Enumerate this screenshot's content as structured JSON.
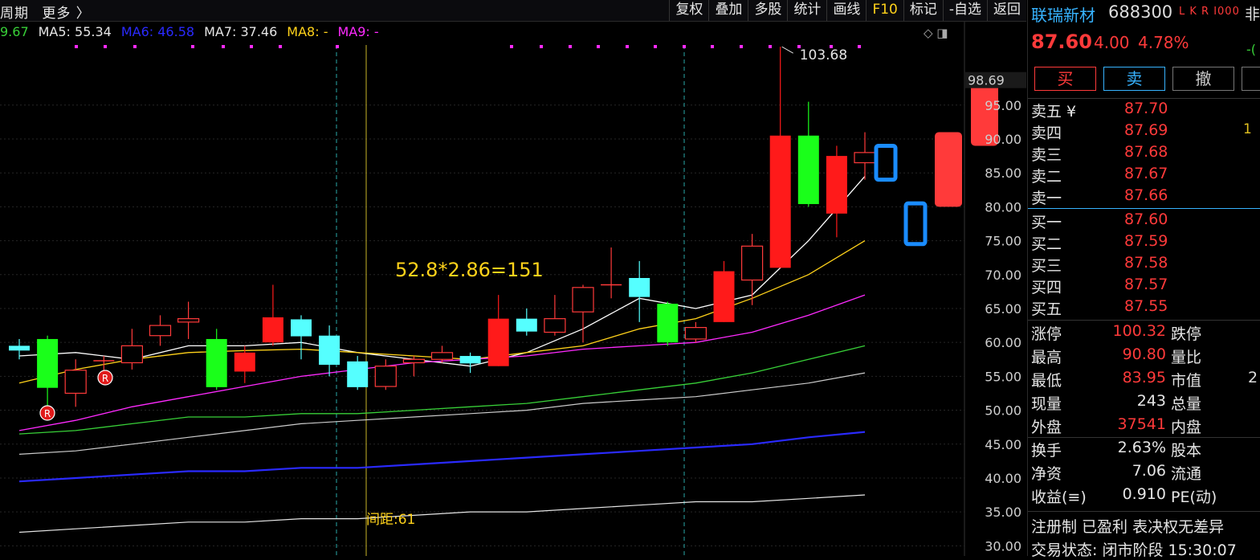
{
  "toolbar": {
    "left_items": [
      "周期",
      "更多 〉"
    ],
    "right_items": [
      "复权",
      "叠加",
      "多股",
      "统计",
      "画线",
      "F10",
      "标记",
      "-自选",
      "返回"
    ]
  },
  "ma_legend": [
    {
      "text": "9.67",
      "color": "#38d038"
    },
    {
      "text": "MA5: 55.34",
      "color": "#e5e5e5"
    },
    {
      "text": "MA6: 46.58",
      "color": "#2a2aff"
    },
    {
      "text": "MA7: 37.46",
      "color": "#e5e5e5"
    },
    {
      "text": "MA8: -",
      "color": "#ffd21a"
    },
    {
      "text": "MA9: -",
      "color": "#ff2aff"
    }
  ],
  "chart_icons": "◇ ◨",
  "annotations": {
    "formula": "52.8*2.86=151",
    "gap": "间距:61",
    "high_label": "103.68",
    "current_label": "98.69",
    "r_badge": "R"
  },
  "chart_data": {
    "type": "candlestick",
    "y_ticks": [
      "30.00",
      "35.00",
      "40.00",
      "45.00",
      "50.00",
      "55.00",
      "60.00",
      "65.00",
      "70.00",
      "75.00",
      "80.00",
      "85.00",
      "90.00",
      "95.00"
    ],
    "ylim": [
      28.5,
      110.5
    ],
    "candles": [
      {
        "x": 0,
        "o": 59.5,
        "c": 58.8,
        "h": 60.5,
        "l": 57.5,
        "t": "cyan"
      },
      {
        "x": 1,
        "o": 53.3,
        "c": 60.5,
        "h": 61.0,
        "l": 49.5,
        "t": "green"
      },
      {
        "x": 2,
        "o": 52.5,
        "c": 55.9,
        "h": 57.5,
        "l": 50.5,
        "t": "redhollow"
      },
      {
        "x": 3,
        "o": 57.3,
        "c": 57.3,
        "h": 58.0,
        "l": 55.5,
        "t": "cross"
      },
      {
        "x": 4,
        "o": 57.0,
        "c": 59.5,
        "h": 62.0,
        "l": 56.0,
        "t": "redhollow"
      },
      {
        "x": 5,
        "o": 61.0,
        "c": 62.5,
        "h": 64.0,
        "l": 59.5,
        "t": "redhollow"
      },
      {
        "x": 6,
        "o": 63.0,
        "c": 63.5,
        "h": 66.0,
        "l": 60.5,
        "t": "redhollow"
      },
      {
        "x": 7,
        "o": 60.5,
        "c": 53.4,
        "h": 62.0,
        "l": 53.0,
        "t": "green"
      },
      {
        "x": 8,
        "o": 55.7,
        "c": 58.5,
        "h": 59.5,
        "l": 54.0,
        "t": "redfilled"
      },
      {
        "x": 9,
        "o": 60.0,
        "c": 63.7,
        "h": 68.5,
        "l": 59.5,
        "t": "redfilled"
      },
      {
        "x": 10,
        "o": 63.4,
        "c": 60.9,
        "h": 64.0,
        "l": 57.5,
        "t": "cyan"
      },
      {
        "x": 11,
        "o": 61.0,
        "c": 56.7,
        "h": 62.5,
        "l": 55.0,
        "t": "cyan"
      },
      {
        "x": 12,
        "o": 57.2,
        "c": 53.4,
        "h": 58.0,
        "l": 53.0,
        "t": "cyan"
      },
      {
        "x": 13,
        "o": 53.5,
        "c": 56.5,
        "h": 57.5,
        "l": 53.0,
        "t": "redhollow"
      },
      {
        "x": 14,
        "o": 57.0,
        "c": 57.5,
        "h": 58.0,
        "l": 55.0,
        "t": "redhollow"
      },
      {
        "x": 15,
        "o": 57.5,
        "c": 58.5,
        "h": 59.5,
        "l": 57.0,
        "t": "redhollow"
      },
      {
        "x": 16,
        "o": 58.0,
        "c": 56.9,
        "h": 58.5,
        "l": 55.5,
        "t": "cyan"
      },
      {
        "x": 17,
        "o": 56.5,
        "c": 63.5,
        "h": 67.0,
        "l": 56.5,
        "t": "redfilled"
      },
      {
        "x": 18,
        "o": 63.5,
        "c": 61.6,
        "h": 65.0,
        "l": 61.0,
        "t": "cyan"
      },
      {
        "x": 19,
        "o": 61.5,
        "c": 63.5,
        "h": 67.0,
        "l": 61.0,
        "t": "redhollow"
      },
      {
        "x": 20,
        "o": 64.5,
        "c": 68.1,
        "h": 68.5,
        "l": 60.0,
        "t": "redhollow"
      },
      {
        "x": 21,
        "o": 68.5,
        "c": 68.5,
        "h": 74.0,
        "l": 66.5,
        "t": "cross"
      },
      {
        "x": 22,
        "o": 69.5,
        "c": 66.7,
        "h": 72.0,
        "l": 63.0,
        "t": "cyan"
      },
      {
        "x": 23,
        "o": 65.7,
        "c": 60.0,
        "h": 66.0,
        "l": 59.5,
        "t": "green"
      },
      {
        "x": 24,
        "o": 60.5,
        "c": 62.2,
        "h": 63.0,
        "l": 60.0,
        "t": "redhollow"
      },
      {
        "x": 25,
        "o": 63.0,
        "c": 70.5,
        "h": 72.0,
        "l": 63.0,
        "t": "redfilled"
      },
      {
        "x": 26,
        "o": 69.2,
        "c": 74.2,
        "h": 76.0,
        "l": 65.5,
        "t": "redhollow"
      },
      {
        "x": 27,
        "o": 71.0,
        "c": 90.5,
        "h": 103.6,
        "l": 71.0,
        "t": "redfilled"
      },
      {
        "x": 28,
        "o": 90.5,
        "c": 80.4,
        "h": 95.5,
        "l": 80.0,
        "t": "green"
      },
      {
        "x": 29,
        "o": 79.0,
        "c": 87.5,
        "h": 89.0,
        "l": 75.5,
        "t": "redfilled"
      },
      {
        "x": 30,
        "o": 86.5,
        "c": 88.0,
        "h": 91.0,
        "l": 84.0,
        "t": "redhollow"
      }
    ],
    "ma_lines": [
      {
        "color": "#ffffff",
        "width": 1.3,
        "points": [
          [
            0,
            58.0
          ],
          [
            2,
            58.5
          ],
          [
            4,
            57.5
          ],
          [
            6,
            59.5
          ],
          [
            8,
            59.5
          ],
          [
            10,
            60.0
          ],
          [
            12,
            58.5
          ],
          [
            14,
            57.5
          ],
          [
            16,
            56.5
          ],
          [
            18,
            58.5
          ],
          [
            20,
            62.0
          ],
          [
            22,
            66.5
          ],
          [
            24,
            65.0
          ],
          [
            26,
            67.0
          ],
          [
            28,
            75.0
          ],
          [
            30,
            84.5
          ]
        ]
      },
      {
        "color": "#ffd21a",
        "width": 1.3,
        "points": [
          [
            0,
            54.0
          ],
          [
            2,
            56.0
          ],
          [
            4,
            57.5
          ],
          [
            6,
            58.5
          ],
          [
            8,
            58.8
          ],
          [
            10,
            59.0
          ],
          [
            12,
            58.5
          ],
          [
            14,
            58.0
          ],
          [
            16,
            57.5
          ],
          [
            18,
            58.5
          ],
          [
            20,
            59.5
          ],
          [
            22,
            62.0
          ],
          [
            24,
            63.5
          ],
          [
            26,
            66.5
          ],
          [
            28,
            70.0
          ],
          [
            30,
            75.0
          ]
        ]
      },
      {
        "color": "#ff2aff",
        "width": 1.3,
        "points": [
          [
            0,
            47.0
          ],
          [
            2,
            48.5
          ],
          [
            4,
            50.5
          ],
          [
            6,
            52.0
          ],
          [
            8,
            53.5
          ],
          [
            10,
            55.0
          ],
          [
            12,
            56.0
          ],
          [
            14,
            57.0
          ],
          [
            16,
            57.5
          ],
          [
            18,
            58.0
          ],
          [
            20,
            59.0
          ],
          [
            22,
            59.5
          ],
          [
            24,
            60.0
          ],
          [
            26,
            61.5
          ],
          [
            28,
            64.0
          ],
          [
            30,
            67.0
          ]
        ]
      },
      {
        "color": "#38d038",
        "width": 1.3,
        "points": [
          [
            0,
            46.5
          ],
          [
            2,
            47.0
          ],
          [
            4,
            48.0
          ],
          [
            6,
            49.0
          ],
          [
            8,
            49.0
          ],
          [
            10,
            49.5
          ],
          [
            12,
            49.5
          ],
          [
            14,
            50.0
          ],
          [
            16,
            50.5
          ],
          [
            18,
            51.0
          ],
          [
            20,
            52.0
          ],
          [
            22,
            53.0
          ],
          [
            24,
            54.0
          ],
          [
            26,
            55.5
          ],
          [
            28,
            57.5
          ],
          [
            30,
            59.5
          ]
        ]
      },
      {
        "color": "#cccccc",
        "width": 1.2,
        "points": [
          [
            0,
            43.5
          ],
          [
            2,
            44.0
          ],
          [
            4,
            45.0
          ],
          [
            6,
            46.0
          ],
          [
            8,
            47.0
          ],
          [
            10,
            48.0
          ],
          [
            12,
            48.5
          ],
          [
            14,
            49.0
          ],
          [
            16,
            49.5
          ],
          [
            18,
            50.0
          ],
          [
            20,
            51.0
          ],
          [
            22,
            51.5
          ],
          [
            24,
            52.0
          ],
          [
            26,
            53.0
          ],
          [
            28,
            54.0
          ],
          [
            30,
            55.5
          ]
        ]
      },
      {
        "color": "#2a2aff",
        "width": 2.2,
        "points": [
          [
            0,
            39.5
          ],
          [
            2,
            40.0
          ],
          [
            4,
            40.5
          ],
          [
            6,
            41.0
          ],
          [
            8,
            41.0
          ],
          [
            10,
            41.5
          ],
          [
            12,
            41.5
          ],
          [
            14,
            42.0
          ],
          [
            16,
            42.5
          ],
          [
            18,
            43.0
          ],
          [
            20,
            43.5
          ],
          [
            22,
            44.0
          ],
          [
            24,
            44.5
          ],
          [
            26,
            45.0
          ],
          [
            28,
            46.0
          ],
          [
            30,
            46.8
          ]
        ]
      },
      {
        "color": "#e5e5e5",
        "width": 1.2,
        "points": [
          [
            0,
            32.0
          ],
          [
            2,
            32.5
          ],
          [
            4,
            33.0
          ],
          [
            6,
            33.5
          ],
          [
            8,
            33.5
          ],
          [
            10,
            34.0
          ],
          [
            12,
            34.0
          ],
          [
            14,
            34.5
          ],
          [
            16,
            35.0
          ],
          [
            18,
            35.0
          ],
          [
            20,
            35.5
          ],
          [
            22,
            36.0
          ],
          [
            24,
            36.5
          ],
          [
            26,
            36.5
          ],
          [
            28,
            37.0
          ],
          [
            30,
            37.5
          ]
        ]
      }
    ],
    "projections": [
      {
        "xpx": 1103,
        "top": 89.0,
        "bottom": 84.0,
        "kind": "blue"
      },
      {
        "xpx": 1140,
        "top": 80.5,
        "bottom": 74.5,
        "kind": "blue"
      },
      {
        "xpx": 1181,
        "top": 91.0,
        "bottom": 80.0,
        "kind": "red"
      },
      {
        "xpx": 1226,
        "top": 99.5,
        "bottom": 89.0,
        "kind": "red"
      }
    ]
  },
  "panel": {
    "name": "联瑞新材",
    "code": "688300",
    "flags": "L K R I000",
    "extra": "非",
    "price": "87.60",
    "change": "4.00",
    "pct": "4.78%",
    "side_cut": "-(",
    "buy": "买",
    "sell": "卖",
    "cancel": "撤",
    "order_book": [
      {
        "label": "卖五 ¥",
        "price": "87.70",
        "vol": ""
      },
      {
        "label": "卖四",
        "price": "87.69",
        "vol": "1"
      },
      {
        "label": "卖三",
        "price": "87.68",
        "vol": ""
      },
      {
        "label": "卖二",
        "price": "87.67",
        "vol": ""
      },
      {
        "label": "卖一",
        "price": "87.66",
        "vol": ""
      },
      {
        "label": "买一",
        "price": "87.60",
        "vol": ""
      },
      {
        "label": "买二",
        "price": "87.59",
        "vol": ""
      },
      {
        "label": "买三",
        "price": "87.58",
        "vol": ""
      },
      {
        "label": "买四",
        "price": "87.57",
        "vol": ""
      },
      {
        "label": "买五",
        "price": "87.55",
        "vol": ""
      }
    ],
    "stats1": [
      {
        "l1": "涨停",
        "v1": "100.32",
        "c1": "red",
        "l2": "跌停",
        "v2": ""
      },
      {
        "l1": "最高",
        "v1": "90.80",
        "c1": "red",
        "l2": "量比",
        "v2": ""
      },
      {
        "l1": "最低",
        "v1": "83.95",
        "c1": "red",
        "l2": "市值",
        "v2": "2"
      },
      {
        "l1": "现量",
        "v1": "243",
        "c1": "white",
        "l2": "总量",
        "v2": ""
      },
      {
        "l1": "外盘",
        "v1": "37541",
        "c1": "red",
        "l2": "内盘",
        "v2": ""
      }
    ],
    "stats2": [
      {
        "l1": "换手",
        "v1": "2.63%",
        "c1": "white",
        "l2": "股本",
        "v2": ""
      },
      {
        "l1": "净资",
        "v1": "7.06",
        "c1": "white",
        "l2": "流通",
        "v2": ""
      },
      {
        "l1": "收益(≡)",
        "v1": "0.910",
        "c1": "white",
        "l2": "PE(动)",
        "v2": ""
      }
    ],
    "note": "注册制 已盈利 表决权无差异",
    "status": "交易状态: 闭市阶段 15:30:07"
  }
}
